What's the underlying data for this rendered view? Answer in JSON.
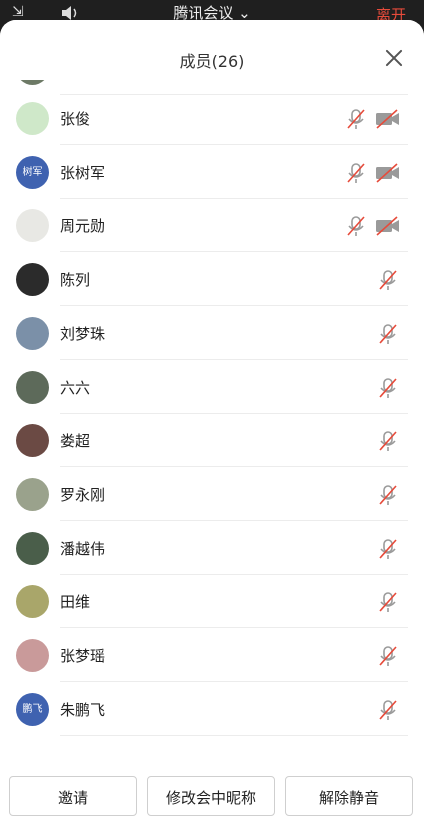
{
  "topbar": {
    "title": "腾讯会议",
    "leave_label": "离开"
  },
  "panel": {
    "title": "成员(26)"
  },
  "members": [
    {
      "name": "张俊",
      "avatar_text": "",
      "avatar_color": "#cfe8c9",
      "cam_icon": "camera-off-icon"
    },
    {
      "name": "张树军",
      "avatar_text": "树军",
      "avatar_color": "#3f62b0",
      "cam_icon": "camera-off-icon"
    },
    {
      "name": "周元勋",
      "avatar_text": "",
      "avatar_color": "#e8e8e4",
      "cam_icon": "camera-off-icon"
    },
    {
      "name": "陈列",
      "avatar_text": "",
      "avatar_color": "#2b2b2b"
    },
    {
      "name": "刘梦珠",
      "avatar_text": "",
      "avatar_color": "#7b90a8"
    },
    {
      "name": "六六",
      "avatar_text": "",
      "avatar_color": "#5d6a5a"
    },
    {
      "name": "娄超",
      "avatar_text": "",
      "avatar_color": "#6b4a44"
    },
    {
      "name": "罗永刚",
      "avatar_text": "",
      "avatar_color": "#9aa28c"
    },
    {
      "name": "潘越伟",
      "avatar_text": "",
      "avatar_color": "#4a5e4a"
    },
    {
      "name": "田维",
      "avatar_text": "",
      "avatar_color": "#a9a66a"
    },
    {
      "name": "张梦瑶",
      "avatar_text": "",
      "avatar_color": "#c99a9a"
    },
    {
      "name": "朱鹏飞",
      "avatar_text": "鹏飞",
      "avatar_color": "#3f62b0"
    }
  ],
  "buttons": {
    "invite": "邀请",
    "rename": "修改会中昵称",
    "unmute_all": "解除静音"
  },
  "colors": {
    "muted_red": "#e64b3b",
    "icon_gray": "#9a9a9a",
    "accent_blue": "#3f62b0"
  }
}
